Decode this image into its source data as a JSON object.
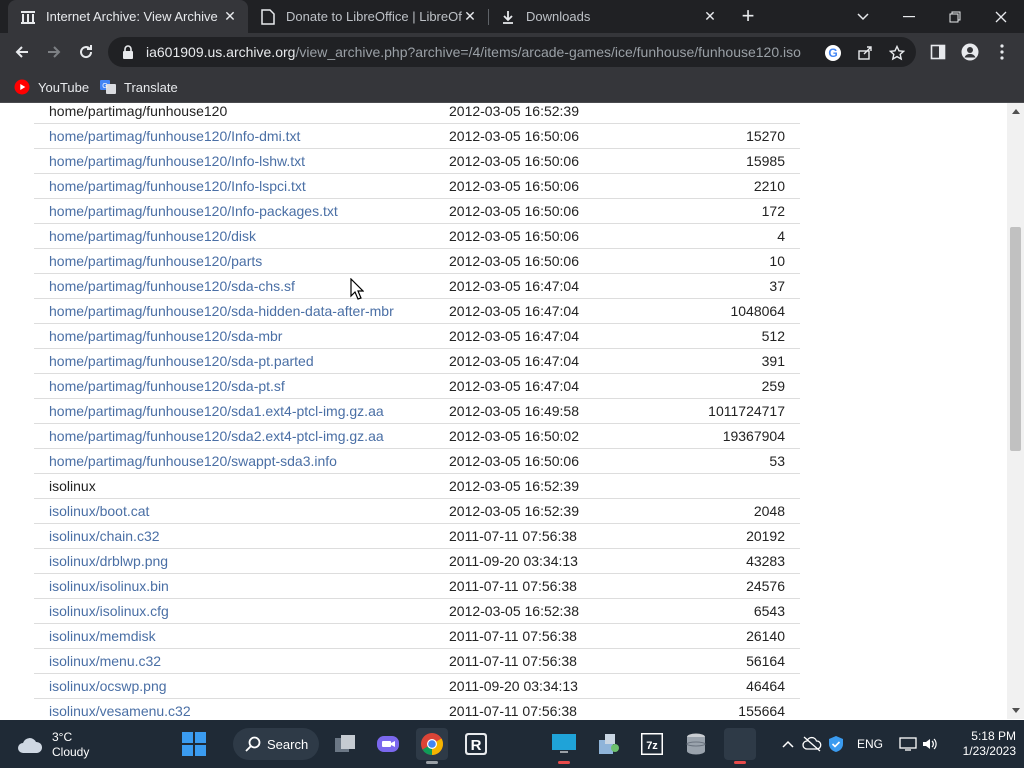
{
  "browser": {
    "tabs": [
      {
        "title": "Internet Archive: View Archive",
        "icon": "archive-icon",
        "active": true
      },
      {
        "title": "Donate to LibreOffice | LibreOffic",
        "icon": "document-icon",
        "active": false
      },
      {
        "title": "Downloads",
        "icon": "download-icon",
        "active": false
      }
    ],
    "url_host": "ia601909.us.archive.org",
    "url_path": "/view_archive.php?archive=/4/items/arcade-games/ice/funhouse/funhouse120.iso",
    "bookmarks": [
      {
        "label": "YouTube",
        "icon": "youtube-icon"
      },
      {
        "label": "Translate",
        "icon": "translate-icon"
      }
    ]
  },
  "listing": [
    {
      "name": "home/partimag/funhouse120",
      "date": "2012-03-05 16:52:39",
      "size": "",
      "is_link": false
    },
    {
      "name": "home/partimag/funhouse120/Info-dmi.txt",
      "date": "2012-03-05 16:50:06",
      "size": "15270",
      "is_link": true
    },
    {
      "name": "home/partimag/funhouse120/Info-lshw.txt",
      "date": "2012-03-05 16:50:06",
      "size": "15985",
      "is_link": true
    },
    {
      "name": "home/partimag/funhouse120/Info-lspci.txt",
      "date": "2012-03-05 16:50:06",
      "size": "2210",
      "is_link": true
    },
    {
      "name": "home/partimag/funhouse120/Info-packages.txt",
      "date": "2012-03-05 16:50:06",
      "size": "172",
      "is_link": true
    },
    {
      "name": "home/partimag/funhouse120/disk",
      "date": "2012-03-05 16:50:06",
      "size": "4",
      "is_link": true
    },
    {
      "name": "home/partimag/funhouse120/parts",
      "date": "2012-03-05 16:50:06",
      "size": "10",
      "is_link": true
    },
    {
      "name": "home/partimag/funhouse120/sda-chs.sf",
      "date": "2012-03-05 16:47:04",
      "size": "37",
      "is_link": true
    },
    {
      "name": "home/partimag/funhouse120/sda-hidden-data-after-mbr",
      "date": "2012-03-05 16:47:04",
      "size": "1048064",
      "is_link": true
    },
    {
      "name": "home/partimag/funhouse120/sda-mbr",
      "date": "2012-03-05 16:47:04",
      "size": "512",
      "is_link": true
    },
    {
      "name": "home/partimag/funhouse120/sda-pt.parted",
      "date": "2012-03-05 16:47:04",
      "size": "391",
      "is_link": true
    },
    {
      "name": "home/partimag/funhouse120/sda-pt.sf",
      "date": "2012-03-05 16:47:04",
      "size": "259",
      "is_link": true
    },
    {
      "name": "home/partimag/funhouse120/sda1.ext4-ptcl-img.gz.aa",
      "date": "2012-03-05 16:49:58",
      "size": "1011724717",
      "is_link": true
    },
    {
      "name": "home/partimag/funhouse120/sda2.ext4-ptcl-img.gz.aa",
      "date": "2012-03-05 16:50:02",
      "size": "19367904",
      "is_link": true
    },
    {
      "name": "home/partimag/funhouse120/swappt-sda3.info",
      "date": "2012-03-05 16:50:06",
      "size": "53",
      "is_link": true
    },
    {
      "name": "isolinux",
      "date": "2012-03-05 16:52:39",
      "size": "",
      "is_link": false
    },
    {
      "name": "isolinux/boot.cat",
      "date": "2012-03-05 16:52:39",
      "size": "2048",
      "is_link": true
    },
    {
      "name": "isolinux/chain.c32",
      "date": "2011-07-11 07:56:38",
      "size": "20192",
      "is_link": true
    },
    {
      "name": "isolinux/drblwp.png",
      "date": "2011-09-20 03:34:13",
      "size": "43283",
      "is_link": true
    },
    {
      "name": "isolinux/isolinux.bin",
      "date": "2011-07-11 07:56:38",
      "size": "24576",
      "is_link": true
    },
    {
      "name": "isolinux/isolinux.cfg",
      "date": "2012-03-05 16:52:38",
      "size": "6543",
      "is_link": true
    },
    {
      "name": "isolinux/memdisk",
      "date": "2011-07-11 07:56:38",
      "size": "26140",
      "is_link": true
    },
    {
      "name": "isolinux/menu.c32",
      "date": "2011-07-11 07:56:38",
      "size": "56164",
      "is_link": true
    },
    {
      "name": "isolinux/ocswp.png",
      "date": "2011-09-20 03:34:13",
      "size": "46464",
      "is_link": true
    },
    {
      "name": "isolinux/vesamenu.c32",
      "date": "2011-07-11 07:56:38",
      "size": "155664",
      "is_link": true
    }
  ],
  "taskbar": {
    "weather_temp": "3°C",
    "weather_desc": "Cloudy",
    "search_label": "Search",
    "language": "ENG",
    "time": "5:18 PM",
    "date": "1/23/2023"
  },
  "colors": {
    "link": "#4a6fa5",
    "chrome_dark": "#202124",
    "chrome_toolbar": "#35363a",
    "taskbar": "#1f2a36"
  }
}
